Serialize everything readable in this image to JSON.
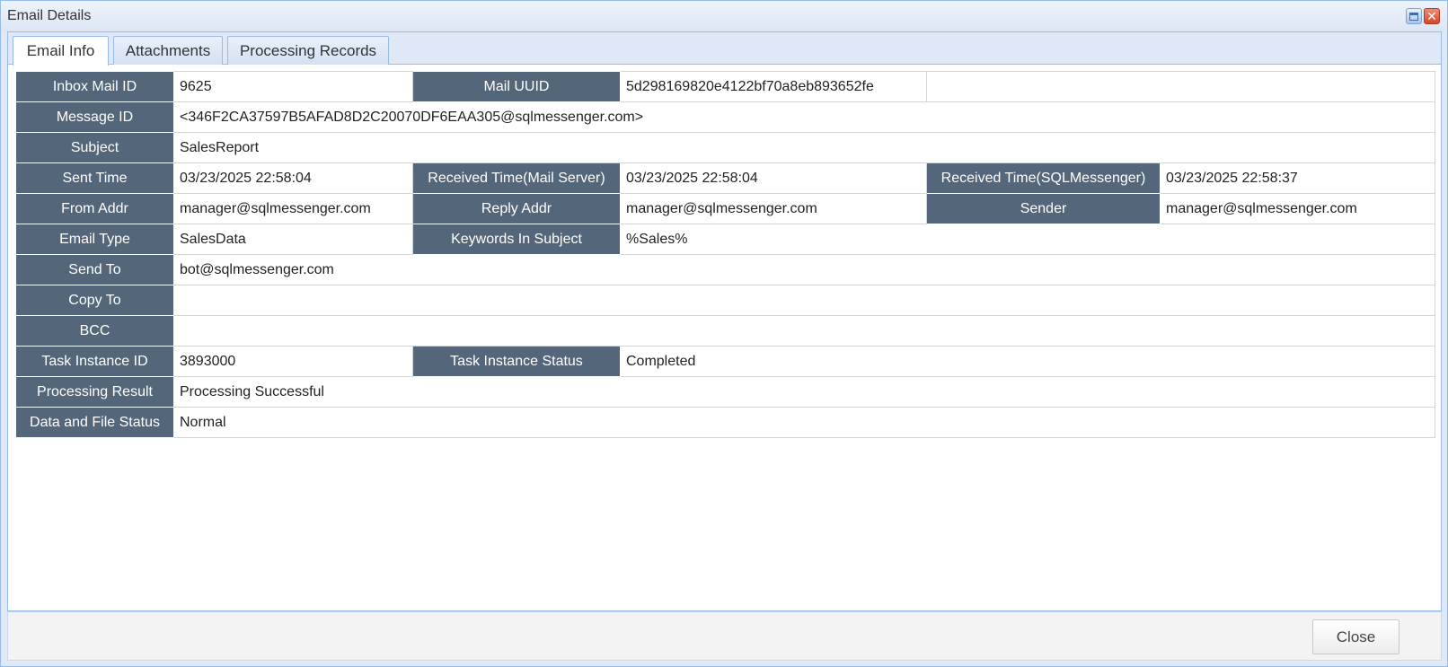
{
  "window": {
    "title": "Email Details"
  },
  "tabs": [
    {
      "label": "Email Info",
      "active": true
    },
    {
      "label": "Attachments",
      "active": false
    },
    {
      "label": "Processing Records",
      "active": false
    }
  ],
  "fields": {
    "inbox_mail_id": {
      "label": "Inbox Mail ID",
      "value": "9625"
    },
    "mail_uuid": {
      "label": "Mail UUID",
      "value": "5d298169820e4122bf70a8eb893652fe"
    },
    "message_id": {
      "label": "Message ID",
      "value": "<346F2CA37597B5AFAD8D2C20070DF6EAA305@sqlmessenger.com>"
    },
    "subject": {
      "label": "Subject",
      "value": "SalesReport"
    },
    "sent_time": {
      "label": "Sent Time",
      "value": "03/23/2025 22:58:04"
    },
    "received_time_mail_server": {
      "label": "Received Time(Mail Server)",
      "value": "03/23/2025 22:58:04"
    },
    "received_time_sqlmessenger": {
      "label": "Received Time(SQLMessenger)",
      "value": "03/23/2025 22:58:37"
    },
    "from_addr": {
      "label": "From Addr",
      "value": "manager@sqlmessenger.com"
    },
    "reply_addr": {
      "label": "Reply Addr",
      "value": "manager@sqlmessenger.com"
    },
    "sender": {
      "label": "Sender",
      "value": "manager@sqlmessenger.com"
    },
    "email_type": {
      "label": "Email Type",
      "value": "SalesData"
    },
    "keywords_in_subject": {
      "label": "Keywords In Subject",
      "value": "%Sales%"
    },
    "send_to": {
      "label": "Send To",
      "value": "bot@sqlmessenger.com"
    },
    "copy_to": {
      "label": "Copy To",
      "value": ""
    },
    "bcc": {
      "label": "BCC",
      "value": ""
    },
    "task_instance_id": {
      "label": "Task Instance ID",
      "value": "3893000"
    },
    "task_instance_status": {
      "label": "Task Instance Status",
      "value": "Completed"
    },
    "processing_result": {
      "label": "Processing Result",
      "value": "Processing Successful"
    },
    "data_and_file_status": {
      "label": "Data and File Status",
      "value": "Normal"
    }
  },
  "footer": {
    "close_label": "Close"
  },
  "colors": {
    "label_background": "#53667a",
    "window_background": "#dfe8f6",
    "border": "#99bbe8"
  }
}
